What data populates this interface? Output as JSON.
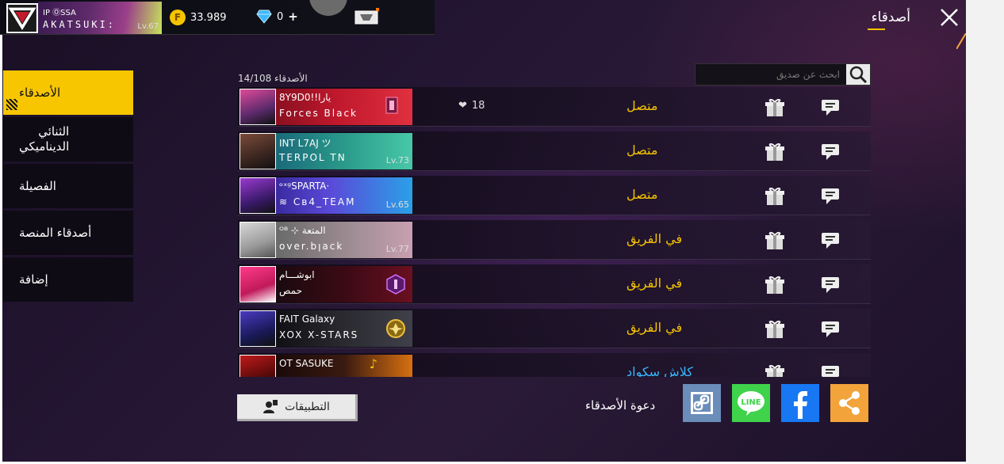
{
  "header": {
    "title": "أصدقاء",
    "player": {
      "tag": "IP  ⓄSSA",
      "name": "AKATSUKI: ",
      "level": "Lv.67"
    },
    "coins": "33.989",
    "diamonds": "0",
    "diamonds_plus": "+"
  },
  "sidebar": {
    "items": [
      {
        "label": "الأصدقاء",
        "active": true
      },
      {
        "label_line1": "الثنائي",
        "label_line2": "الديناميكي"
      },
      {
        "label": "الفصيلة"
      },
      {
        "label": "أصدقاء المنصة"
      },
      {
        "label": "إضافة"
      }
    ]
  },
  "list": {
    "count_label": "الأصدقاء 14/108",
    "search_placeholder": "ابحث عن صديق",
    "rows": [
      {
        "name1": "8Y9D0!!يارا",
        "name2": "Forces  Black",
        "level": "",
        "likes": "18",
        "status": "متصل"
      },
      {
        "name1": "INT    L7AJ ツ",
        "name2": "TERPOL  TN",
        "level": "Lv.73",
        "likes": "",
        "status": "متصل"
      },
      {
        "name1": "ᵒˣᵍSPARTA·",
        "name2": "≋ Cв4_TEAM",
        "level": "Lv.65",
        "likes": "",
        "status": "متصل"
      },
      {
        "name1": "ᴼᴮ ⊹ المتعة",
        "name2": "oᴠer.bꞁack",
        "level": "Lv.77",
        "likes": "",
        "status": "في الفريق"
      },
      {
        "name1": "ابوشـــام",
        "name2": "حمص",
        "level": "",
        "likes": "",
        "status": "في الفريق"
      },
      {
        "name1": "FAIT   Galaxy",
        "name2": "XOX   X-STARS",
        "level": "",
        "likes": "",
        "status": "في الفريق"
      },
      {
        "name1": "OT   SASUKE",
        "name2": "",
        "level": "",
        "likes": "",
        "status": "كلاش سكواد"
      }
    ]
  },
  "footer": {
    "apps_label": "التطبيقات",
    "invite_label": "دعوة الأصدقاء",
    "share_buttons": [
      "link-icon",
      "line-icon",
      "facebook-icon",
      "share-icon"
    ]
  },
  "colors": {
    "accent": "#f7c600",
    "status_online": "#f5c400",
    "status_clash": "#38b6ff",
    "facebook": "#1877f2",
    "line": "#3ed34b",
    "share": "#f2a33a",
    "link": "#6a8dba"
  }
}
